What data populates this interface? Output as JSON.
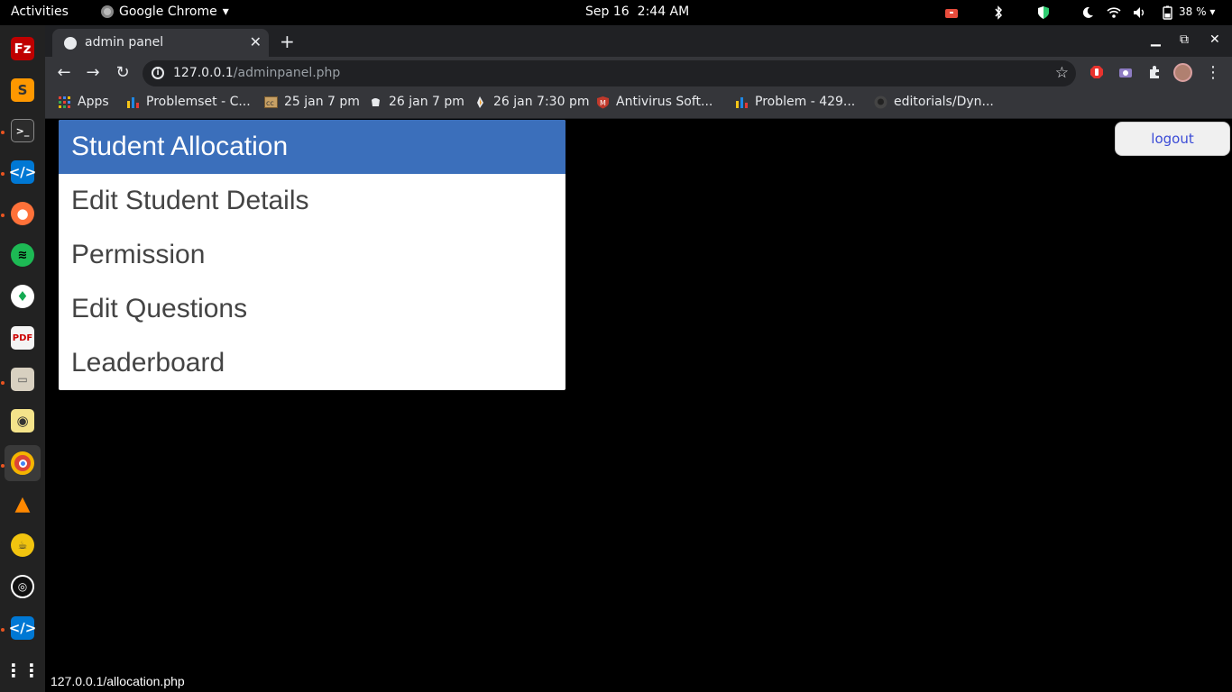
{
  "topbar": {
    "activities": "Activities",
    "app_name": "Google Chrome",
    "date": "Sep 16",
    "time": "2:44 AM",
    "battery": "38 %"
  },
  "tab": {
    "title": "admin panel",
    "close": "✕",
    "new_tab": "+"
  },
  "toolbar": {
    "url_host": "127.0.0.1",
    "url_path": "/adminpanel.php"
  },
  "bookmarks": [
    {
      "label": "Apps",
      "icon": "apps-grid-icon",
      "color": "#e74c3c"
    },
    {
      "label": "Problemset - C...",
      "icon": "codeforces-icon",
      "color": "#f5c518"
    },
    {
      "label": "25 jan 7 pm",
      "icon": "codechef-cc-icon",
      "color": "#c8a165"
    },
    {
      "label": "26 jan 7 pm",
      "icon": "codechef-icon",
      "color": "#e8eaed"
    },
    {
      "label": "26 jan 7:30 pm",
      "icon": "atcoder-icon",
      "color": "#e8eaed"
    },
    {
      "label": "Antivirus Soft...",
      "icon": "mcafee-icon",
      "color": "#c0392b"
    },
    {
      "label": "Problem - 429...",
      "icon": "codeforces-icon",
      "color": "#f5c518"
    },
    {
      "label": "editorials/Dyn...",
      "icon": "github-icon",
      "color": "#555"
    }
  ],
  "menu": {
    "items": [
      {
        "label": "Student Allocation",
        "active": true
      },
      {
        "label": "Edit Student Details",
        "active": false
      },
      {
        "label": "Permission",
        "active": false
      },
      {
        "label": "Edit Questions",
        "active": false
      },
      {
        "label": "Leaderboard",
        "active": false
      }
    ]
  },
  "logout_label": "logout",
  "status_url": "127.0.0.1/allocation.php",
  "colors": {
    "active_menu": "#3b6fbb",
    "logout_text": "#3b4bd6"
  }
}
